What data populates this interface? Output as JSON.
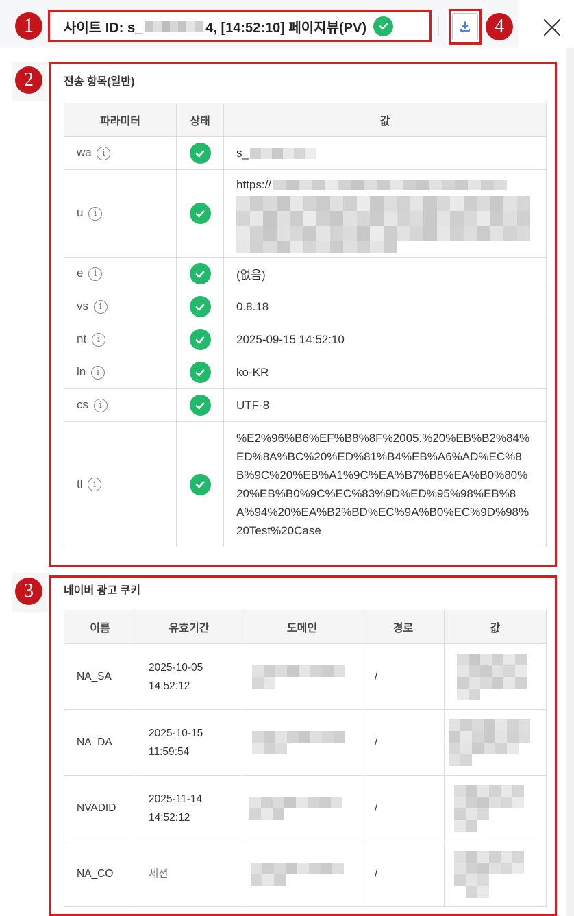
{
  "header": {
    "site_id_prefix": "사이트 ID: s_",
    "site_id_suffix": "4, [14:52:10] 페이지뷰(PV)",
    "download_icon": "download-icon",
    "close_icon": "close-icon",
    "status_icon": "check-circle-icon",
    "status_color": "#22b96a"
  },
  "markers": [
    "1",
    "2",
    "3",
    "4"
  ],
  "marker_color": "#c4151c",
  "highlight_color": "#e01a1a",
  "params_section": {
    "title": "전송 항목(일반)",
    "columns": [
      "파라미터",
      "상태",
      "값"
    ],
    "info_icon_glyph": "i",
    "rows": [
      {
        "param": "wa",
        "status": "ok",
        "value": "s_"
      },
      {
        "param": "u",
        "status": "ok",
        "value": "https://"
      },
      {
        "param": "e",
        "status": "ok",
        "value": "(없음)"
      },
      {
        "param": "vs",
        "status": "ok",
        "value": "0.8.18"
      },
      {
        "param": "nt",
        "status": "ok",
        "value": "2025-09-15 14:52:10"
      },
      {
        "param": "ln",
        "status": "ok",
        "value": "ko-KR"
      },
      {
        "param": "cs",
        "status": "ok",
        "value": "UTF-8"
      },
      {
        "param": "tl",
        "status": "ok",
        "value": "%E2%96%B6%EF%B8%8F%2005.%20%EB%B2%84%ED%8A%BC%20%ED%81%B4%EB%A6%AD%EC%8B%9C%20%EB%A1%9C%EA%B7%B8%EA%B0%80%20%EB%B0%9C%EC%83%9D%ED%95%98%EB%8A%94%20%EA%B2%BD%EC%9A%B0%EC%9D%98%20Test%20Case"
      }
    ]
  },
  "cookies_section": {
    "title": "네이버 광고 쿠키",
    "columns": [
      "이름",
      "유효기간",
      "도메인",
      "경로",
      "값"
    ],
    "rows": [
      {
        "name": "NA_SA",
        "expires": "2025-10-05 14:52:12",
        "path": "/"
      },
      {
        "name": "NA_DA",
        "expires": "2025-10-15 11:59:54",
        "path": "/"
      },
      {
        "name": "NVADID",
        "expires": "2025-11-14 14:52:12",
        "path": "/"
      },
      {
        "name": "NA_CO",
        "expires": "세션",
        "path": "/"
      }
    ]
  }
}
